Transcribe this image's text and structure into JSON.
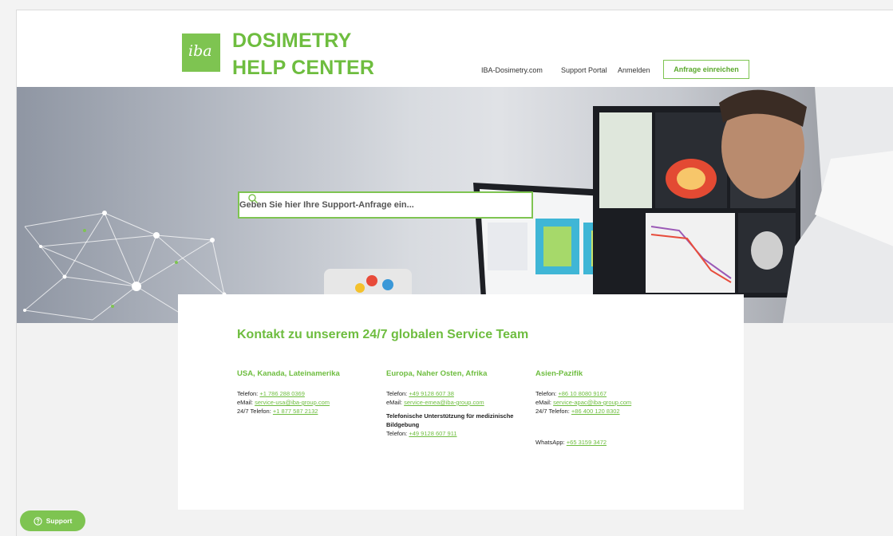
{
  "header": {
    "logo_mark": "iba",
    "title_line1": "DOSIMETRY",
    "title_line2": "HELP CENTER",
    "nav": {
      "dosimetry": "IBA-Dosimetry.com",
      "portal": "Support Portal",
      "login": "Anmelden",
      "request": "Anfrage einreichen"
    }
  },
  "hero": {
    "search_placeholder": "Geben Sie hier Ihre Support-Anfrage ein..."
  },
  "contact": {
    "title": "Kontakt zu unserem 24/7 globalen Service Team",
    "columns": [
      {
        "heading": "USA, Kanada, Lateinamerika",
        "phone_label": "Telefon:",
        "phone": "+1 786 288 0369",
        "email_label": "eMail:",
        "email": "service-usa@iba-group.com",
        "phone247_label": "24/7 Telefon:",
        "phone247": "+1 877 587 2132"
      },
      {
        "heading": "Europa, Naher Osten, Afrika",
        "phone_label": "Telefon:",
        "phone": "+49 9128 607 38",
        "email_label": "eMail:",
        "email": "service-emea@iba-group.com",
        "note": "Telefonische Unterstützung für medizinische Bildgebung",
        "phone2_label": "Telefon:",
        "phone2": "+49 9128 607 911"
      },
      {
        "heading": "Asien-Pazifik",
        "phone_label": "Telefon:",
        "phone": "+86 10 8080 9167",
        "email_label": "eMail:",
        "email": "service-apac@iba-group.com",
        "phone247_label": "24/7 Telefon:",
        "phone247": "+86 400 120 8302",
        "whatsapp_label": "WhatsApp:",
        "whatsapp": "+65 3159 3472"
      }
    ]
  },
  "support_button": {
    "label": "Support",
    "icon": "help-circle-icon"
  },
  "colors": {
    "accent": "#7ec451",
    "accent_text": "#6ebd3f"
  }
}
